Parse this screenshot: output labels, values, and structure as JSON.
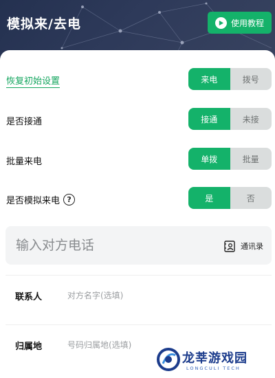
{
  "header": {
    "title": "模拟来/去电",
    "tutorial_label": "使用教程"
  },
  "settings": {
    "reset_label": "恢复初始设置",
    "reset_toggle": {
      "options": [
        "来电",
        "拨号"
      ],
      "selected": "来电"
    },
    "answer_label": "是否接通",
    "answer_toggle": {
      "options": [
        "接通",
        "未接"
      ],
      "selected": "接通"
    },
    "batch_label": "批量来电",
    "batch_toggle": {
      "options": [
        "单拨",
        "批量"
      ],
      "selected": "单拨"
    },
    "simulate_label": "是否模拟来电",
    "simulate_help": "?",
    "simulate_toggle": {
      "options": [
        "是",
        "否"
      ],
      "selected": "是"
    }
  },
  "phone": {
    "placeholder": "输入对方电话",
    "value": "",
    "contacts_label": "通讯录"
  },
  "form": {
    "contact_label": "联系人",
    "contact_placeholder": "对方名字(选填)",
    "location_label": "归属地",
    "location_placeholder": "号码归属地(选填)"
  },
  "watermark": {
    "text": "龙莘游戏园",
    "sub": "LONGCULI TECH"
  },
  "colors": {
    "accent": "#14b26a",
    "header_bg": "#2e3a5a",
    "toggle_off": "#dadddd",
    "input_bg": "#f3f4f5"
  },
  "icons": [
    "play-icon",
    "help-icon",
    "contacts-icon",
    "watermark-logo-icon"
  ]
}
